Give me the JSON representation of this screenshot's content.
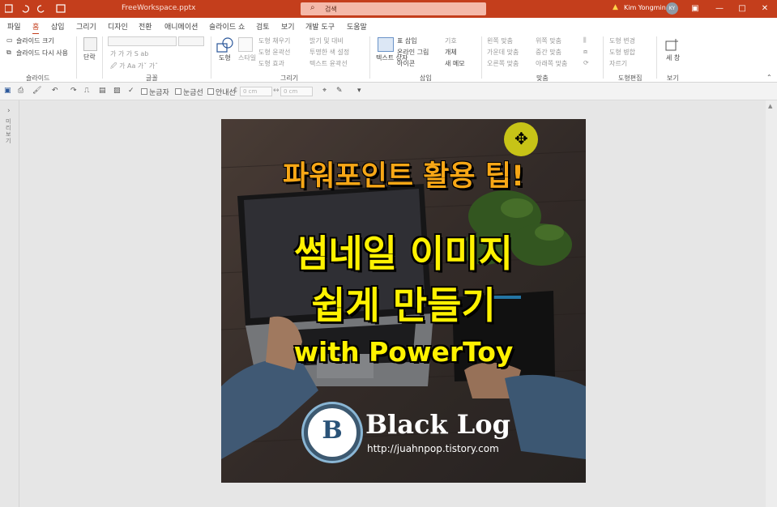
{
  "window": {
    "file_name": "FreeWorkspace.pptx",
    "search_placeholder": "검색",
    "user_name": "Kim Yongmin",
    "avatar_initials": "KY",
    "accent_color": "#c43e1c"
  },
  "tabs": [
    "파일",
    "홈",
    "삽입",
    "그리기",
    "디자인",
    "전환",
    "애니메이션",
    "슬라이드 쇼",
    "검토",
    "보기",
    "개발 도구",
    "도움말"
  ],
  "active_tab": "홈",
  "share_label": "공유",
  "memo_label": "메모",
  "ribbon": {
    "slide_group": {
      "label": "슬라이드",
      "size_btn": "슬라이드 크기",
      "reuse_btn": "슬라이드 다시 사용"
    },
    "paragraph_btn": "단락",
    "font_group": {
      "label": "글꼴"
    },
    "drawing_group": {
      "label": "그리기",
      "shape_btn": "도형",
      "style_btn": "스타일",
      "fill": "도형 채우기",
      "outline": "도형 윤곽선",
      "effect": "도형 효과",
      "brightness": "밝기 및 대비",
      "transparent": "투명한 색 설정",
      "text_outline": "텍스트 윤곽선"
    },
    "insert_group": {
      "label": "삽입",
      "textbox_btn": "텍스트 상자",
      "table": "표 삽입",
      "online_pic": "온라인 그림",
      "icons": "아이콘",
      "symbol": "기호",
      "object": "개체",
      "new_memo": "새 메모"
    },
    "align_group": {
      "label": "맞춤",
      "left": "왼쪽 맞춤",
      "center": "가운데 맞춤",
      "right": "오른쪽 맞춤",
      "top": "위쪽 맞춤",
      "middle": "중간 맞춤",
      "bottom": "아래쪽 맞춤"
    },
    "shape_edit_group": {
      "label": "도형편집",
      "change": "도형 변경",
      "merge": "도형 병합",
      "crop": "자르기"
    },
    "view_group": {
      "label": "보기",
      "ruler_btn": "세 창"
    }
  },
  "qat": {
    "ruler": "눈금자",
    "gridlines": "눈금선",
    "guides": "안내선",
    "width_value": "0 cm",
    "height_value": "0 cm"
  },
  "left_pane_label": "미리 보기",
  "slide": {
    "line1": "파워포인트 활용 팁!",
    "line2": "썸네일 이미지",
    "line3": "쉽게 만들기",
    "line4": "with PowerToy",
    "logo_letter": "B",
    "brand": "Black Log",
    "url": "http://juahnpop.tistory.com"
  }
}
